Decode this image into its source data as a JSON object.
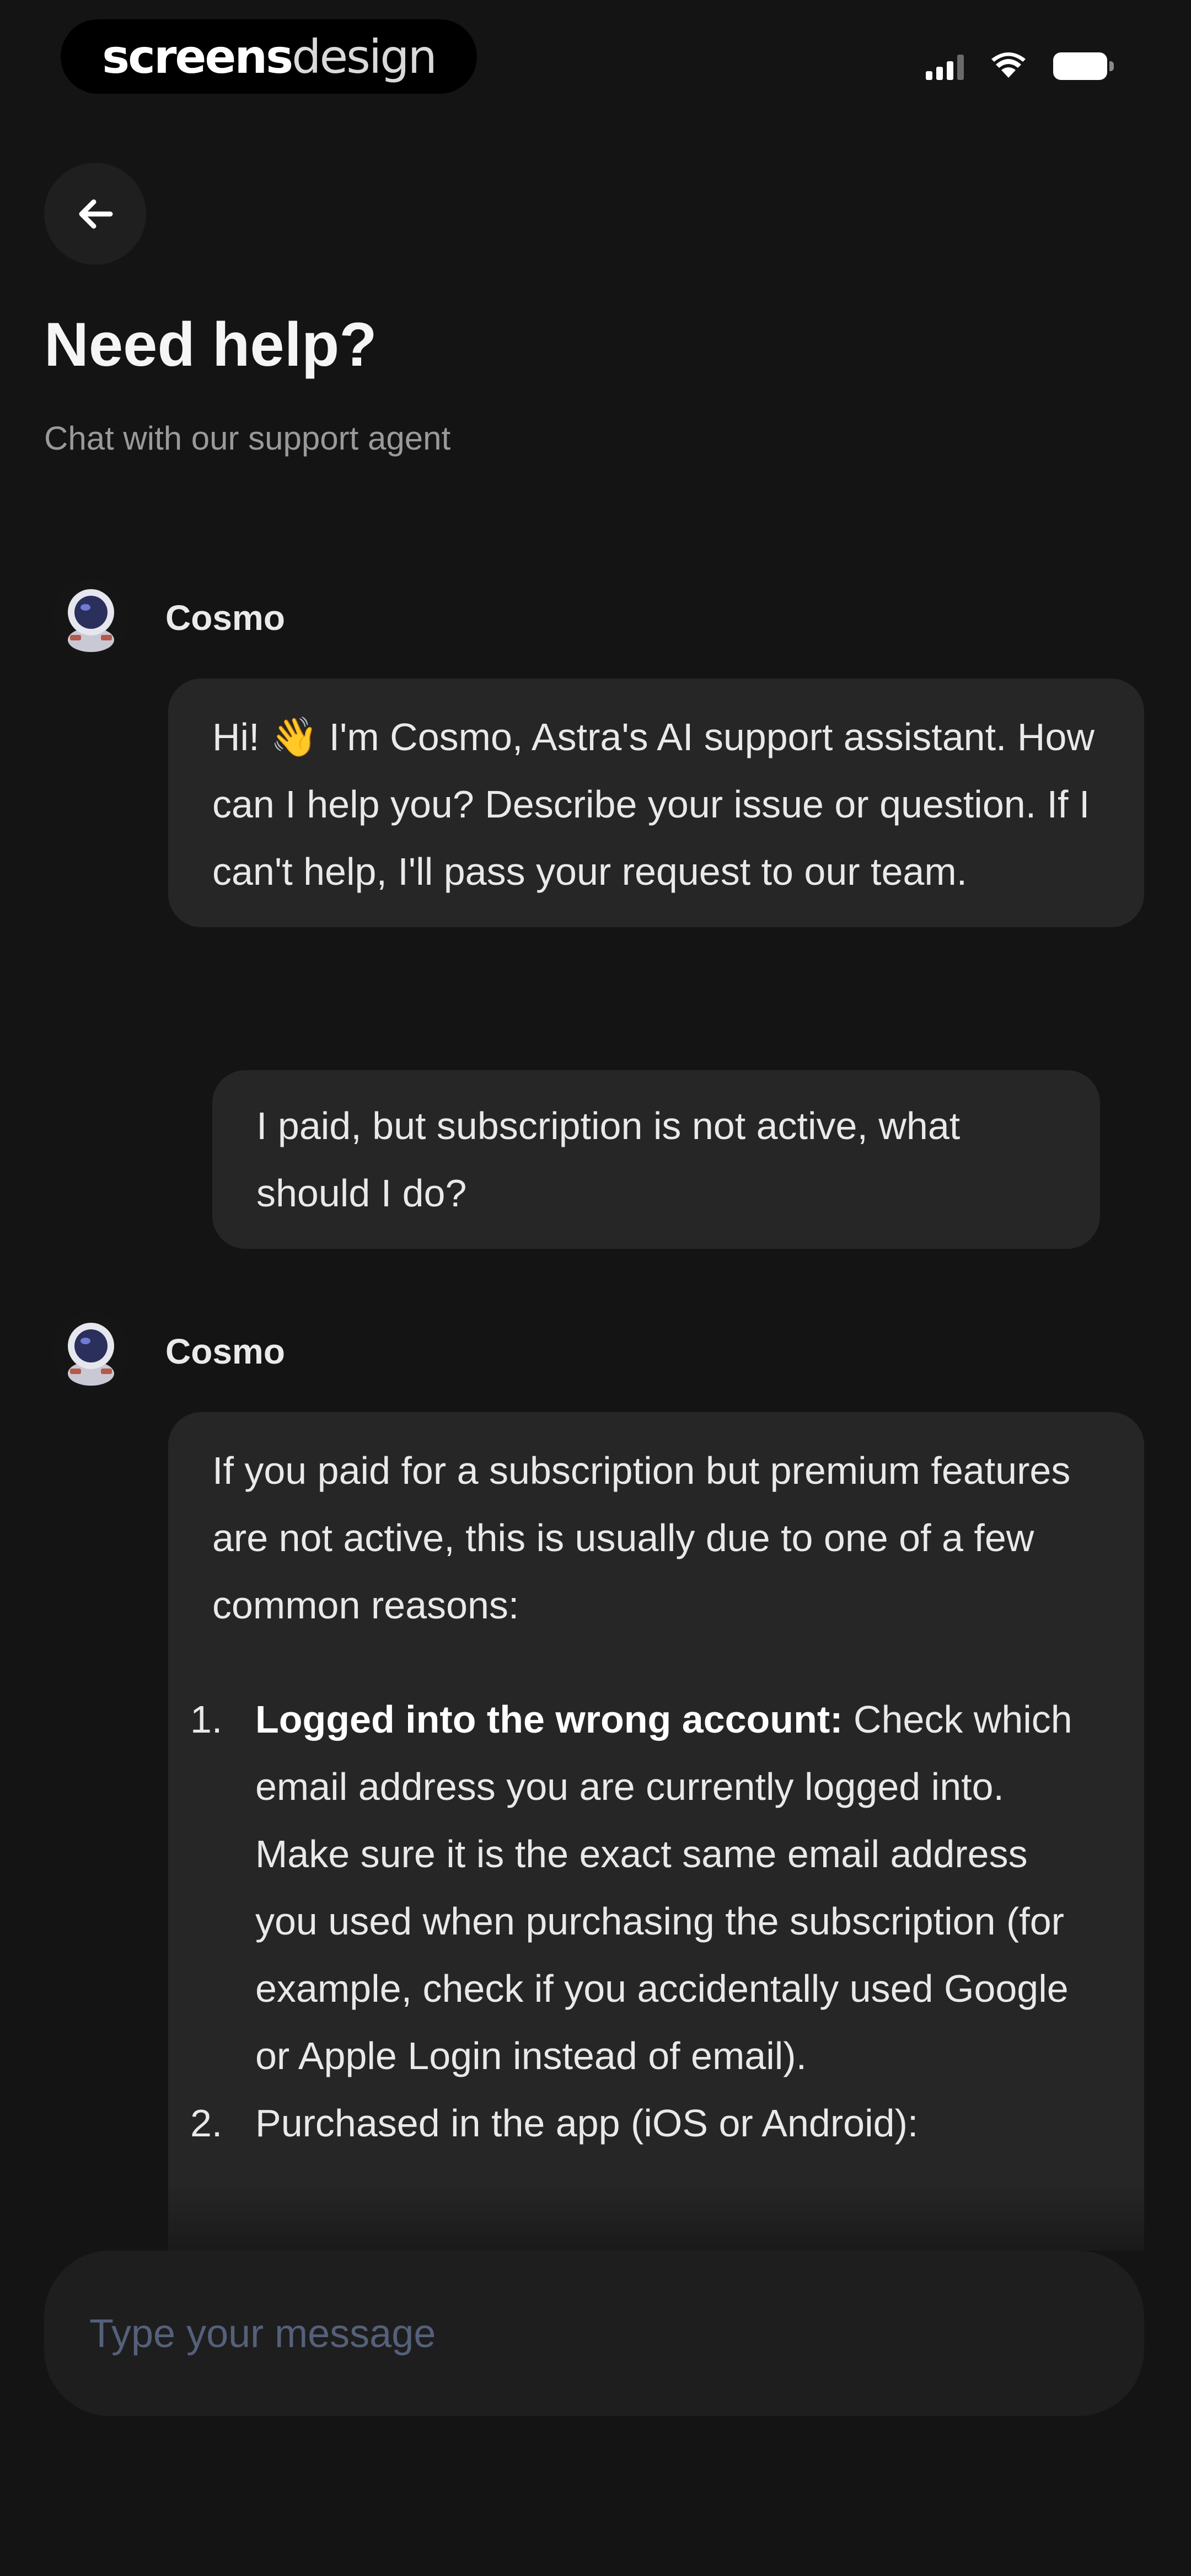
{
  "status_bar": {
    "brand_bold": "screens",
    "brand_light": "design"
  },
  "header": {
    "title": "Need help?",
    "subtitle": "Chat with our support agent"
  },
  "chat": {
    "agent_name": "Cosmo",
    "messages": [
      {
        "role": "agent",
        "sender": "Cosmo",
        "text": "Hi! 👋 I'm Cosmo, Astra's AI support assistant. How can I help you? Describe your issue or question. If I can't help, I'll pass your request to our team."
      },
      {
        "role": "user",
        "text": "I paid, but subscription is not active, what should I do?"
      },
      {
        "role": "agent",
        "sender": "Cosmo",
        "intro": "If you paid for a subscription but premium features are not active, this is usually due to one of a few common reasons:",
        "list": [
          {
            "number": "1.",
            "bold": "Logged into the wrong account:",
            "text": " Check which email address you are currently logged into. Make sure it is the exact same email address you used when purchasing the subscription (for example, check if you accidentally used Google or Apple Login instead of email)."
          },
          {
            "number": "2.",
            "bold": "",
            "text": "Purchased in the app (iOS or Android):"
          }
        ]
      }
    ]
  },
  "composer": {
    "placeholder": "Type your message"
  },
  "colors": {
    "background": "#141414",
    "bubble": "#262626",
    "input": "#1e1e1e",
    "placeholder": "#55607a"
  }
}
